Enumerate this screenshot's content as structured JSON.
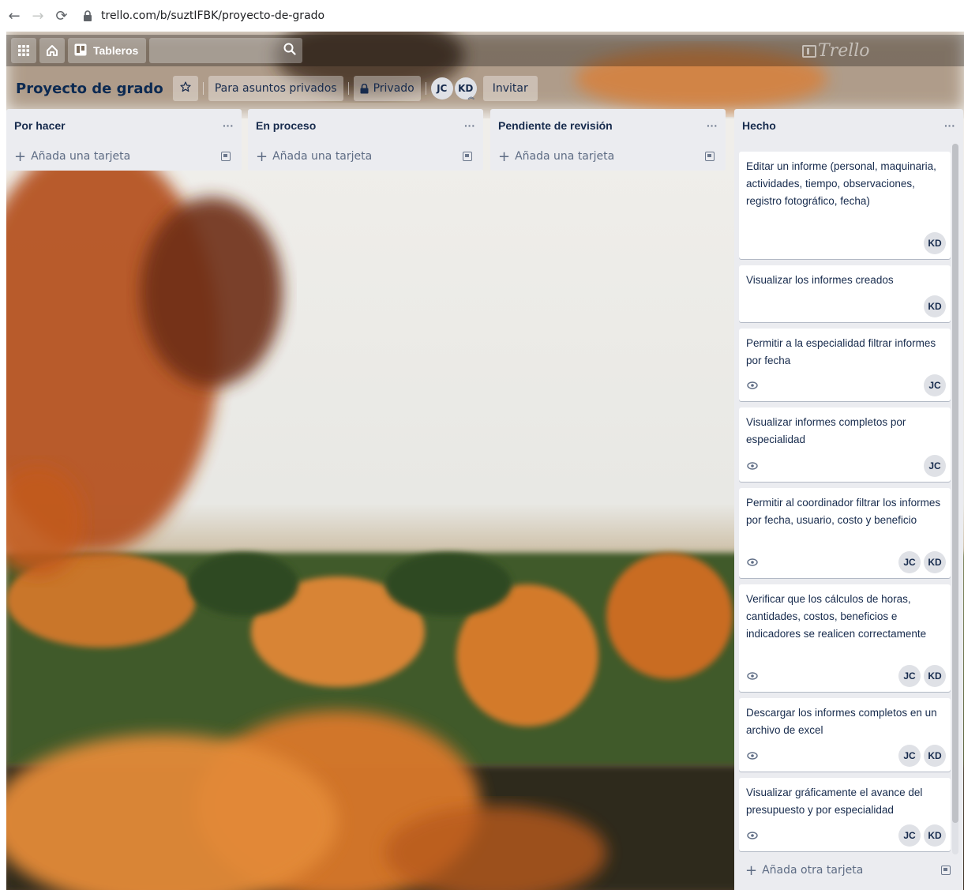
{
  "browser": {
    "url": "trello.com/b/suztIFBK/proyecto-de-grado"
  },
  "topbar": {
    "boards_label": "Tableros",
    "logo_text": "Trello"
  },
  "board": {
    "title": "Proyecto de grado",
    "workspace": "Para asuntos privados",
    "visibility": "Privado",
    "members": [
      "JC",
      "KD"
    ],
    "invite_label": "Invitar"
  },
  "lists": [
    {
      "name": "Por hacer",
      "add_label": "Añada una tarjeta"
    },
    {
      "name": "En proceso",
      "add_label": "Añada una tarjeta"
    },
    {
      "name": "Pendiente de revisión",
      "add_label": "Añada una tarjeta"
    }
  ],
  "done_list": {
    "name": "Hecho",
    "add_label": "Añada otra tarjeta",
    "cards": [
      {
        "title": "Editar un informe (personal, maquinaria, actividades, tiempo, observaciones, registro fotográfico, fecha)",
        "members": [
          "KD"
        ],
        "watched": false
      },
      {
        "title": "Visualizar los informes creados",
        "members": [
          "KD"
        ],
        "watched": false
      },
      {
        "title": "Permitir a la especialidad filtrar informes por fecha",
        "members": [
          "JC"
        ],
        "watched": true
      },
      {
        "title": "Visualizar informes completos por especialidad",
        "members": [
          "JC"
        ],
        "watched": true
      },
      {
        "title": "Permitir al coordinador filtrar los informes por fecha, usuario, costo y beneficio",
        "members": [
          "JC",
          "KD"
        ],
        "watched": true
      },
      {
        "title": "Verificar que los cálculos de horas, cantidades, costos, beneficios e indicadores se realicen correctamente",
        "members": [
          "JC",
          "KD"
        ],
        "watched": true
      },
      {
        "title": "Descargar los informes completos en un archivo de excel",
        "members": [
          "JC",
          "KD"
        ],
        "watched": true
      },
      {
        "title": "Visualizar gráficamente el avance del presupuesto y por especialidad",
        "members": [
          "JC",
          "KD"
        ],
        "watched": true
      }
    ]
  },
  "list_menu_glyph": "···",
  "colors": {
    "list_bg": "#ebecf0",
    "text": "#172b4d",
    "board_title": "#0c2a52",
    "avatar_bg": "#dfe1e6"
  }
}
